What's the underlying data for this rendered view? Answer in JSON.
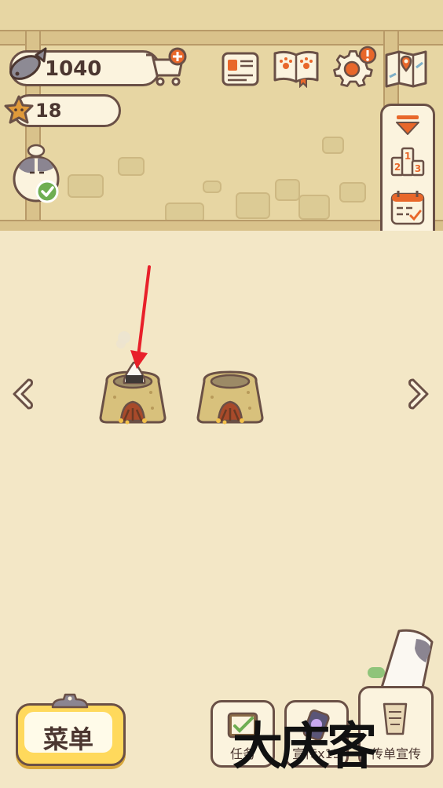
{
  "currency": {
    "fish_count": "1040",
    "star_count": "18"
  },
  "icons": {
    "fish": "fish-icon",
    "cart": "cart-plus-icon",
    "star": "star-icon",
    "recipe_book": "recipe-card-icon",
    "paw_book": "paw-book-icon",
    "settings": "gear-icon",
    "map": "map-icon",
    "collapse": "chevron-down-icon",
    "ranking": "podium-icon",
    "calendar": "calendar-check-icon",
    "camera": "camera-icon"
  },
  "podium_digits": [
    "2",
    "1",
    "3"
  ],
  "bottom_bar": {
    "menu_label": "菜单",
    "task_label": "任务",
    "promo_label": "宣传x15",
    "flyer_label": "传单宣传"
  },
  "watermark": "大庆客",
  "colors": {
    "outline": "#6a5046",
    "wall": "#e7d6a3",
    "ground": "#f3e7c6",
    "menu_button": "#ffd95c",
    "arrow": "#e8202a",
    "notification": "#e8672a",
    "check_badge": "#6fae52"
  }
}
